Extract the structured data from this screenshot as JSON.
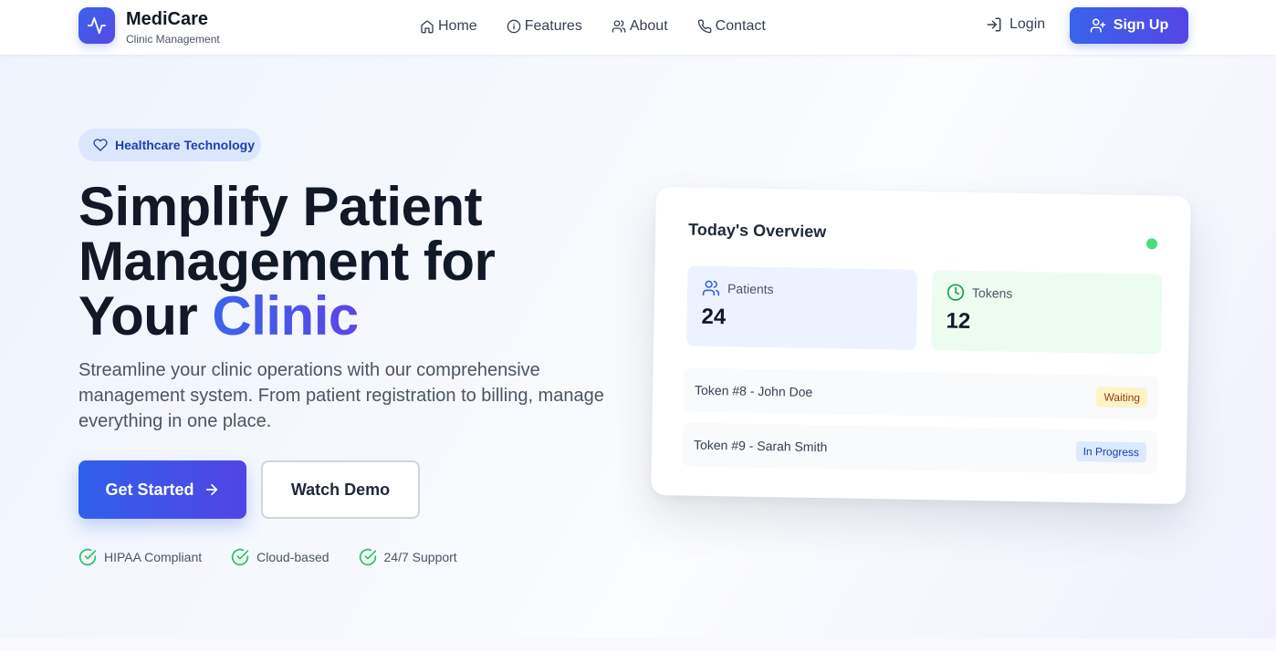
{
  "brand": {
    "name": "MediCare",
    "subtitle": "Clinic Management",
    "logo_icon": "activity-icon",
    "accent_color": "#3b63ea"
  },
  "nav": {
    "items": [
      {
        "label": "Home",
        "icon": "home-icon"
      },
      {
        "label": "Features",
        "icon": "info-icon"
      },
      {
        "label": "About",
        "icon": "users-icon"
      },
      {
        "label": "Contact",
        "icon": "phone-icon"
      }
    ],
    "login_label": "Login",
    "signup_label": "Sign Up"
  },
  "hero": {
    "tag": "Healthcare Technology",
    "title_line1": "Simplify Patient",
    "title_line2": "Management for",
    "title_line3_prefix": "Your",
    "title_accent": "Clinic",
    "description": "Streamline your clinic operations with our comprehensive management system. From patient registration to billing, manage everything in one place.",
    "primary_cta": "Get Started",
    "secondary_cta": "Watch Demo",
    "features": [
      "HIPAA Compliant",
      "Cloud-based",
      "24/7 Support"
    ]
  },
  "overview": {
    "title": "Today's Overview",
    "status_color": "#4ade80",
    "stats": [
      {
        "label": "Patients",
        "value": "24",
        "icon": "users-icon",
        "color": "#3b63ea"
      },
      {
        "label": "Tokens",
        "value": "12",
        "icon": "clock-icon",
        "color": "#16a34a"
      }
    ],
    "queue": [
      {
        "text": "Token #8 - John Doe",
        "status": "Waiting"
      },
      {
        "text": "Token #9 - Sarah Smith",
        "status": "In Progress"
      }
    ]
  }
}
